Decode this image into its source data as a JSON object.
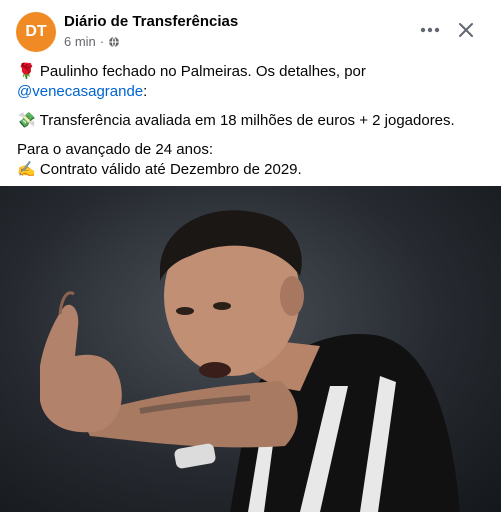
{
  "post": {
    "page_name": "Diário de Transferências",
    "avatar_initials": "DT",
    "time": "6 min",
    "separator": "·",
    "line1_emoji": "🌹",
    "line1_text": "Paulinho fechado no Palmeiras. Os detalhes, por",
    "mention": "@venecasagrande",
    "mention_suffix": ":",
    "line3_emoji": "💸",
    "line3_text": "Transferência avaliada em 18 milhões de euros + 2 jogadores.",
    "line4_text": "Para o avançado de 24 anos:",
    "line5_emoji": "✍️",
    "line5_text": "Contrato válido até Dezembro de 2029.",
    "more_icon": "···",
    "close_icon": "✕"
  },
  "colors": {
    "avatar": "#f08a24",
    "link": "#0064d1",
    "meta": "#65676b"
  }
}
